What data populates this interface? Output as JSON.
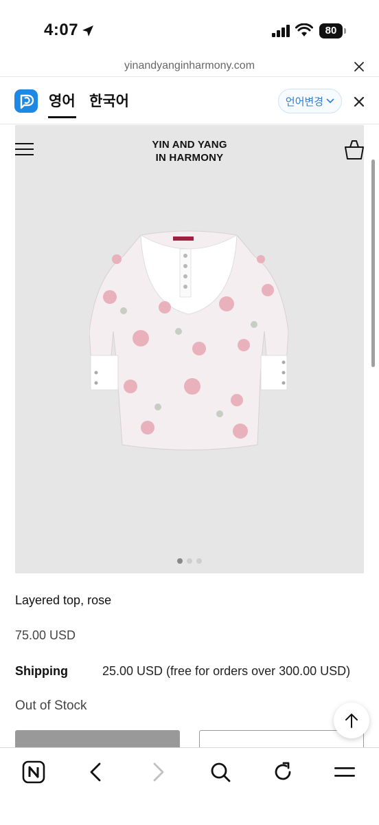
{
  "status_bar": {
    "time": "4:07",
    "battery": "80"
  },
  "browser": {
    "url": "yinandyanginharmony.com"
  },
  "translate_bar": {
    "source_language": "영어",
    "target_language": "한국어",
    "change_language_label": "언어변경",
    "accent_color": "#1e88e5"
  },
  "site": {
    "brand_line1": "YIN AND YANG",
    "brand_line2": "IN HARMONY"
  },
  "product": {
    "title": "Layered top, rose",
    "price": "75.00 USD",
    "shipping_label": "Shipping",
    "shipping_value": "25.00 USD (free for orders over 300.00 USD)",
    "stock_status": "Out of Stock",
    "image_count": 3,
    "active_image_index": 0
  },
  "icons": {
    "location": "location-arrow-icon",
    "signal": "cellular-signal-icon",
    "wifi": "wifi-icon",
    "menu": "hamburger-menu-icon",
    "cart": "shopping-basket-icon",
    "scroll_top": "arrow-up-icon",
    "bottom_bar": [
      "naver-home-icon",
      "back-icon",
      "forward-icon",
      "search-icon",
      "refresh-icon",
      "menu-icon"
    ]
  }
}
